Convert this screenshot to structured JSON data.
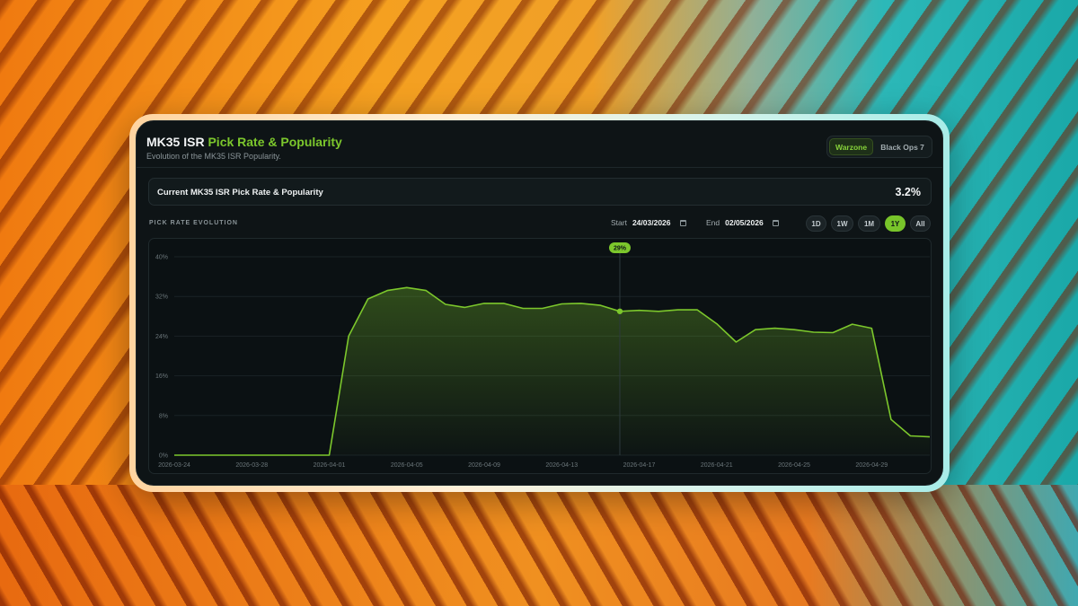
{
  "header": {
    "title_main": "MK35 ISR",
    "title_accent": "Pick Rate & Popularity",
    "subtitle": "Evolution of the MK35 ISR Popularity."
  },
  "game_tabs": [
    {
      "label": "Warzone",
      "active": true
    },
    {
      "label": "Black Ops 7",
      "active": false
    }
  ],
  "current": {
    "label": "Current MK35 ISR Pick Rate & Popularity",
    "value": "3.2%"
  },
  "controls": {
    "section_label": "PICK RATE EVOLUTION",
    "start_label": "Start",
    "start_value": "24/03/2026",
    "end_label": "End",
    "end_value": "02/05/2026",
    "ranges": [
      {
        "label": "1D",
        "active": false
      },
      {
        "label": "1W",
        "active": false
      },
      {
        "label": "1M",
        "active": false
      },
      {
        "label": "1Y",
        "active": true
      },
      {
        "label": "All",
        "active": false
      }
    ]
  },
  "colors": {
    "accent": "#7cc72c",
    "background": "#0e1416"
  },
  "chart_data": {
    "type": "area",
    "x": [
      "2026-03-24",
      "2026-03-25",
      "2026-03-26",
      "2026-03-27",
      "2026-03-28",
      "2026-03-29",
      "2026-03-30",
      "2026-03-31",
      "2026-04-01",
      "2026-04-02",
      "2026-04-03",
      "2026-04-04",
      "2026-04-05",
      "2026-04-06",
      "2026-04-07",
      "2026-04-08",
      "2026-04-09",
      "2026-04-10",
      "2026-04-11",
      "2026-04-12",
      "2026-04-13",
      "2026-04-14",
      "2026-04-15",
      "2026-04-16",
      "2026-04-17",
      "2026-04-18",
      "2026-04-19",
      "2026-04-20",
      "2026-04-21",
      "2026-04-22",
      "2026-04-23",
      "2026-04-24",
      "2026-04-25",
      "2026-04-26",
      "2026-04-27",
      "2026-04-28",
      "2026-04-29",
      "2026-04-30",
      "2026-05-01",
      "2026-05-02"
    ],
    "values": [
      0,
      0,
      0,
      0,
      0,
      0,
      0,
      0,
      0,
      24,
      31.5,
      33.2,
      33.8,
      33.2,
      30.4,
      29.8,
      30.6,
      30.6,
      29.6,
      29.6,
      30.5,
      30.6,
      30.2,
      29,
      29.2,
      29,
      29.3,
      29.3,
      26.5,
      22.8,
      25.3,
      25.6,
      25.3,
      24.8,
      24.7,
      26.4,
      25.6,
      7.2,
      3.9,
      3.7
    ],
    "x_tick_labels": [
      "2026-03-24",
      "2026-03-28",
      "2026-04-01",
      "2026-04-05",
      "2026-04-09",
      "2026-04-13",
      "2026-04-17",
      "2026-04-21",
      "2026-04-25",
      "2026-04-29"
    ],
    "y_tick_labels": [
      "0%",
      "8%",
      "16%",
      "24%",
      "32%",
      "40%"
    ],
    "ylim": [
      0,
      40
    ],
    "grid": true,
    "tooltip": {
      "x": "2026-04-16",
      "label": "29%"
    },
    "title": "",
    "xlabel": "",
    "ylabel": ""
  }
}
